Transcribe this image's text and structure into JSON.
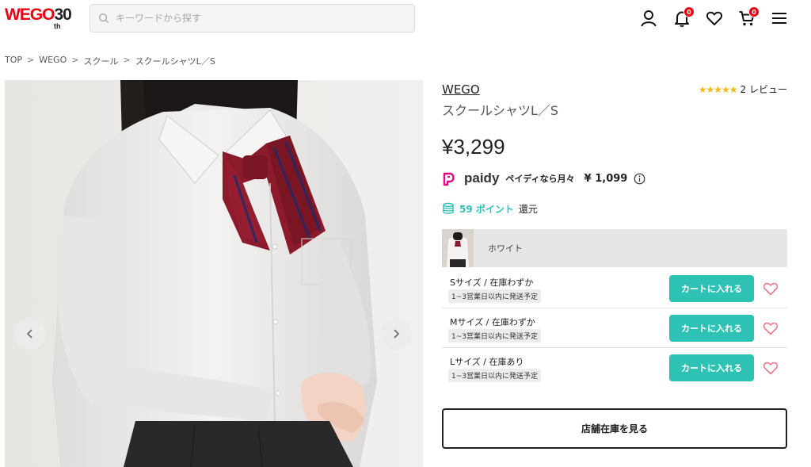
{
  "header": {
    "logo_text": "WEGO",
    "logo_number": "30",
    "logo_suffix": "th",
    "search_placeholder": "キーワードから探す",
    "notification_count": "0",
    "cart_count": "0"
  },
  "breadcrumb": [
    "TOP",
    "WEGO",
    "スクール",
    "スクールシャツL／S"
  ],
  "breadcrumb_separator": ">",
  "product": {
    "brand": "WEGO",
    "name": "スクールシャツL／S",
    "price": "¥3,299",
    "rating_stars": "★★★★★",
    "review_text": "2 レビュー",
    "paidy_logo": "paidy",
    "paidy_text": "ペイディなら月々",
    "paidy_amount": "¥ 1,099",
    "points_number": "59 ポイント",
    "points_suffix": "還元",
    "color_name": "ホワイト",
    "sizes": [
      {
        "stock": "Sサイズ / 在庫わずか",
        "shipping": "1~3営業日以内に発送予定",
        "cart_label": "カートに入れる"
      },
      {
        "stock": "Mサイズ / 在庫わずか",
        "shipping": "1~3営業日以内に発送予定",
        "cart_label": "カートに入れる"
      },
      {
        "stock": "Lサイズ / 在庫あり",
        "shipping": "1~3営業日以内に発送予定",
        "cart_label": "カートに入れる"
      }
    ],
    "store_stock_label": "店舗在庫を見る"
  },
  "colors": {
    "accent": "#2dc2b4",
    "brand_red": "#e60012",
    "star": "#f6b81a",
    "heart": "#e87a8a",
    "paidy_pink": "#e5007f"
  },
  "icons": {
    "search": "search-icon",
    "account": "user-icon",
    "notifications": "bell-icon",
    "favorites": "heart-icon",
    "cart": "cart-icon",
    "menu": "hamburger-icon",
    "points": "coin-stack-icon",
    "info": "info-icon"
  }
}
